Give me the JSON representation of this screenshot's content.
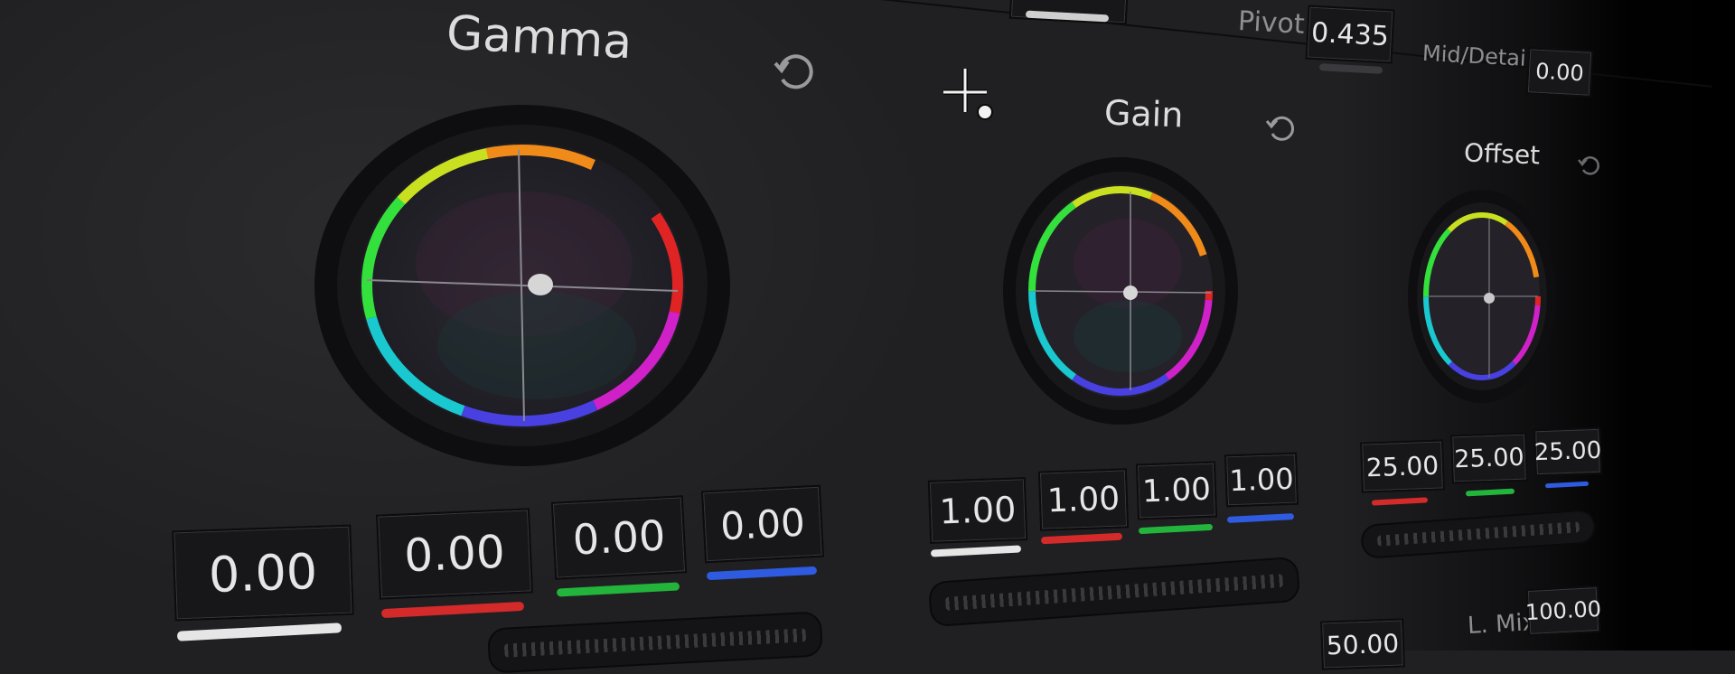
{
  "colors": {
    "bg": "#202023",
    "field_bg": "#17171a",
    "bar_master": "#e6e6e6",
    "bar_red": "#d42a2a",
    "bar_green": "#23b43c",
    "bar_blue": "#2e5be0"
  },
  "gamma": {
    "title": "Gamma",
    "reset_icon": "reset-icon",
    "master": "0.00",
    "red": "0.00",
    "green": "0.00",
    "blue": "0.00"
  },
  "gain": {
    "title": "Gain",
    "reset_icon": "reset-icon",
    "master": "1.00",
    "red": "1.00",
    "green": "1.00",
    "blue": "1.00"
  },
  "offset": {
    "title": "Offset",
    "reset_icon": "reset-icon",
    "red": "25.00",
    "green": "25.00",
    "blue": "25.00"
  },
  "top_right": {
    "pivot_label": "Pivot",
    "pivot_value": "0.435",
    "middetail_label": "Mid/Detail",
    "middetail_value": "0.00"
  },
  "bottom_right": {
    "lmix_label": "L. Mix",
    "lmix_value": "100.00",
    "partial_value": "50.00"
  },
  "picker_icon": "color-picker-crosshair-icon"
}
